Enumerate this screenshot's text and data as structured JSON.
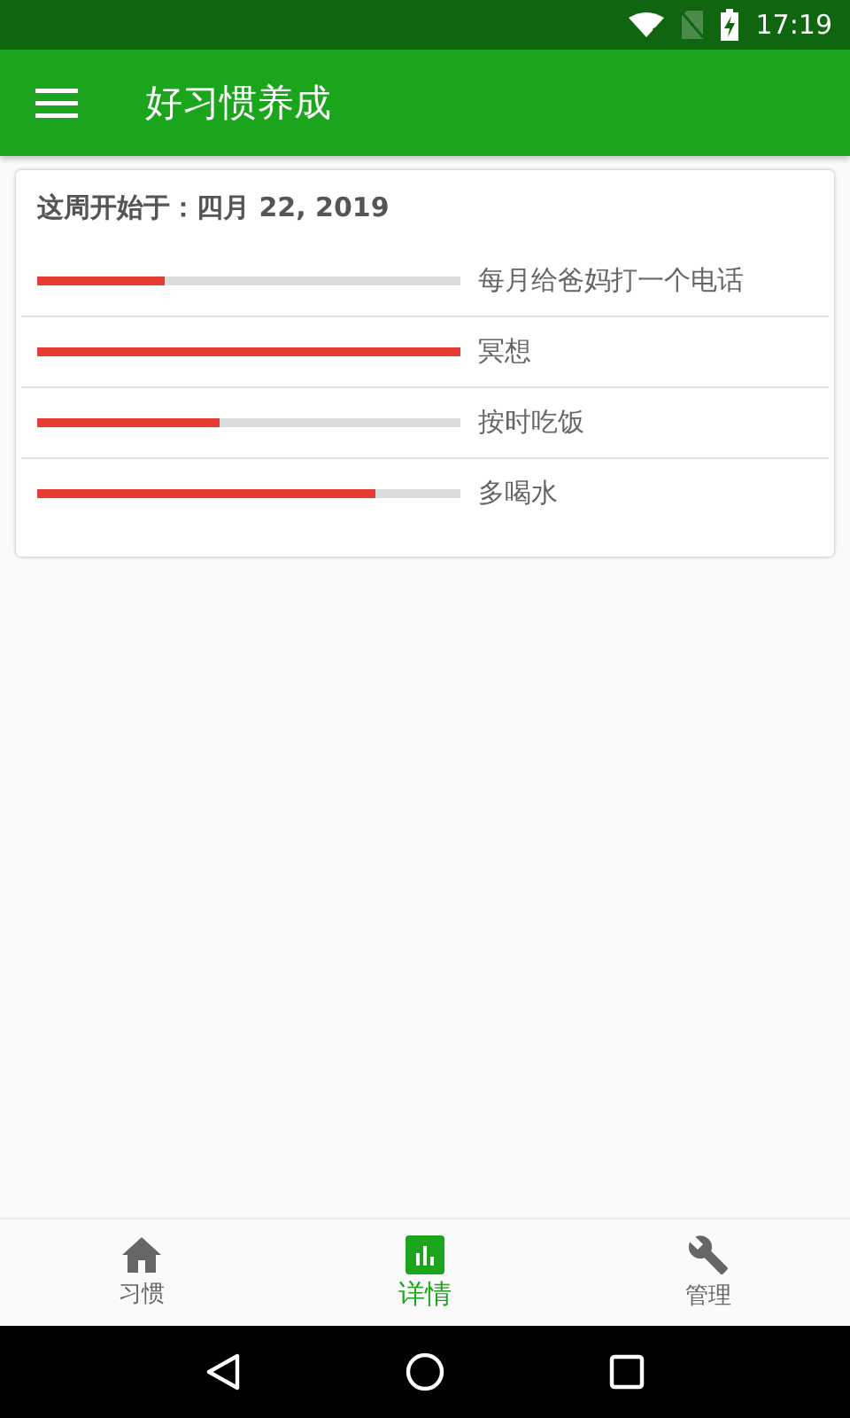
{
  "status_bar": {
    "time": "17:19"
  },
  "app_bar": {
    "title": "好习惯养成"
  },
  "card": {
    "heading": "这周开始于：四月 22, 2019",
    "habits": [
      {
        "name": "每月给爸妈打一个电话",
        "level": 0.3
      },
      {
        "name": "冥想",
        "level": 1.0
      },
      {
        "name": "按时吃饭",
        "level": 0.43
      },
      {
        "name": "多喝水",
        "level": 0.8
      }
    ]
  },
  "bottom_nav": [
    {
      "label": "习惯",
      "kind": "home",
      "selected": false
    },
    {
      "label": "详情",
      "kind": "chart",
      "selected": true
    },
    {
      "label": "管理",
      "kind": "wrench",
      "selected": false
    }
  ]
}
